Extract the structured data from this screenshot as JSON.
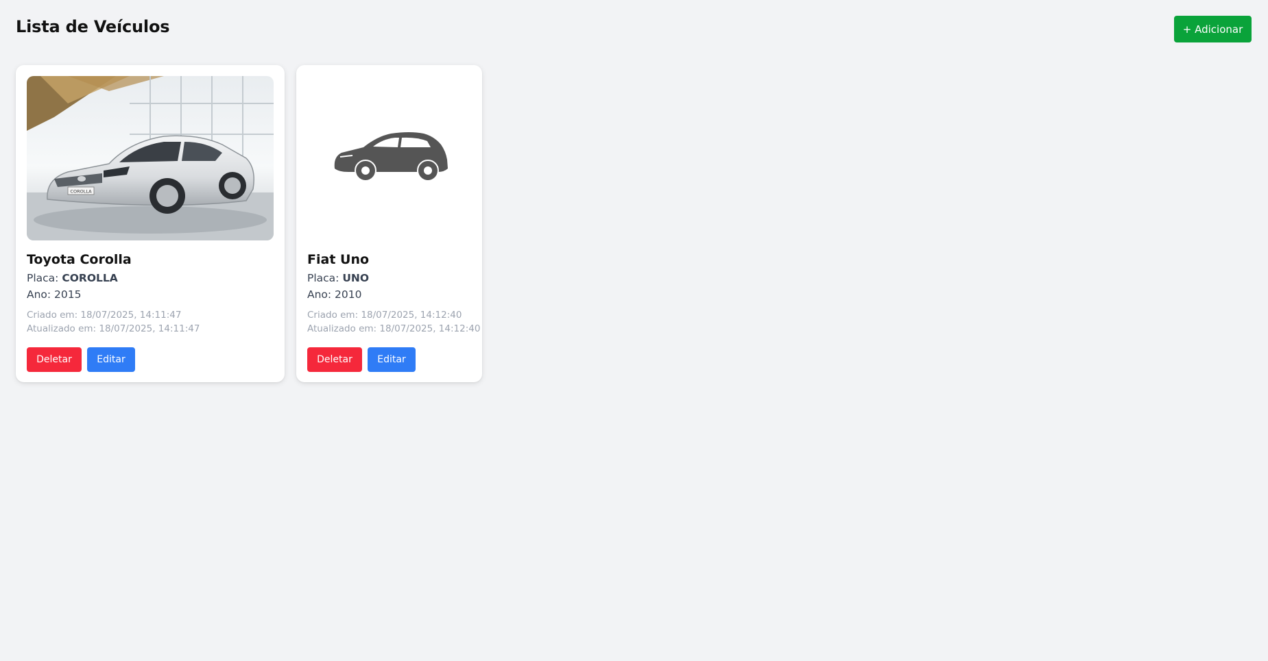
{
  "header": {
    "title": "Lista de Veículos",
    "add_label": "+ Adicionar"
  },
  "vehicles": [
    {
      "name": "Toyota Corolla",
      "placa_label": "Placa:",
      "placa": "COROLLA",
      "ano_text": "Ano: 2015",
      "created_text": "Criado em: 18/07/2025, 14:11:47",
      "updated_text": "Atualizado em: 18/07/2025, 14:11:47",
      "delete_label": "Deletar",
      "edit_label": "Editar",
      "image": "car-photo",
      "badge_text": "COROLLA"
    },
    {
      "name": "Fiat Uno",
      "placa_label": "Placa:",
      "placa": "UNO",
      "ano_text": "Ano: 2010",
      "created_text": "Criado em: 18/07/2025, 14:12:40",
      "updated_text": "Atualizado em: 18/07/2025, 14:12:40",
      "delete_label": "Deletar",
      "edit_label": "Editar",
      "image": "car-silhouette-placeholder"
    }
  ],
  "colors": {
    "background": "#f2f3f5",
    "add_button": "#0aa33a",
    "delete_button": "#f5283b",
    "edit_button": "#2f7cf6"
  }
}
